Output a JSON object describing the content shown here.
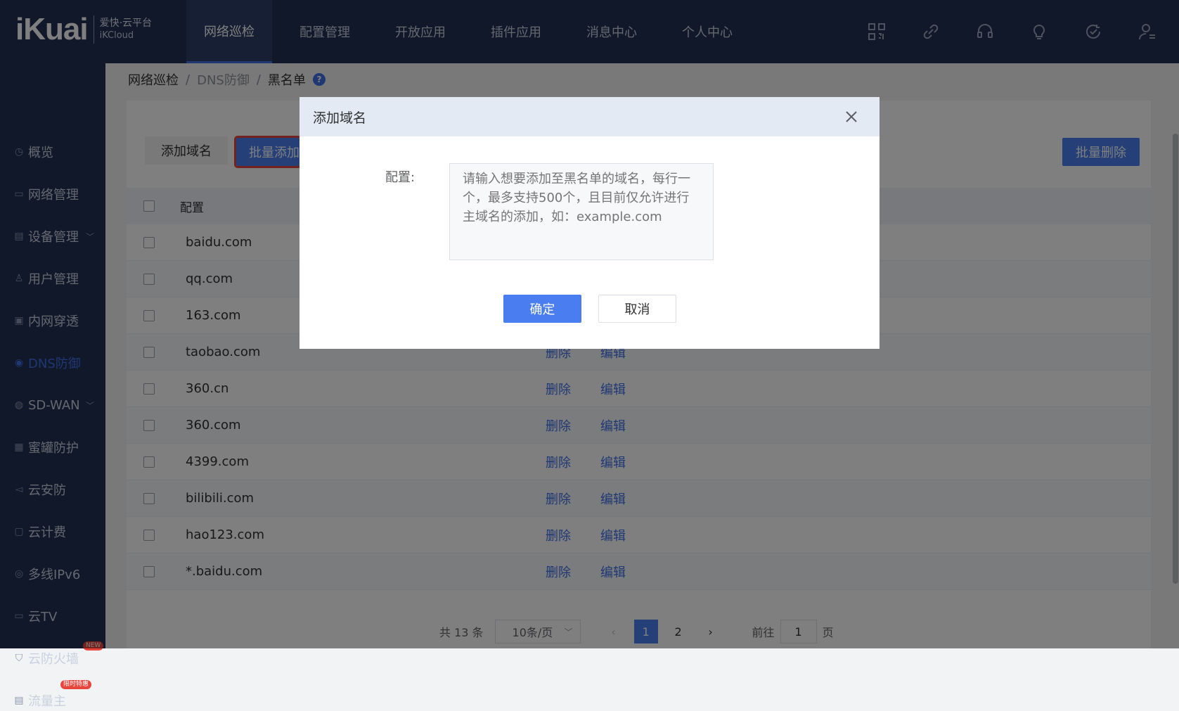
{
  "brand": {
    "logo_text": "iKuai",
    "cn_name": "爱快·云平台",
    "en_name": "iKCloud"
  },
  "top_nav": [
    {
      "label": "网络巡检"
    },
    {
      "label": "配置管理"
    },
    {
      "label": "开放应用"
    },
    {
      "label": "插件应用"
    },
    {
      "label": "消息中心"
    },
    {
      "label": "个人中心"
    }
  ],
  "top_icons": [
    "qrcode-icon",
    "link-icon",
    "headset-icon",
    "lightbulb-icon",
    "refresh-target-icon",
    "user-icon"
  ],
  "sidebar": {
    "items": [
      {
        "label": "概览",
        "icon": "clock-icon"
      },
      {
        "label": "网络管理",
        "icon": "monitor-icon"
      },
      {
        "label": "设备管理",
        "icon": "device-icon",
        "has_children": true
      },
      {
        "label": "用户管理",
        "icon": "user-icon"
      },
      {
        "label": "内网穿透",
        "icon": "tunnel-icon"
      },
      {
        "label": "DNS防御",
        "icon": "dns-icon",
        "active": true
      },
      {
        "label": "SD-WAN",
        "icon": "globe-icon",
        "has_children": true
      },
      {
        "label": "蜜罐防护",
        "icon": "honeypot-icon"
      },
      {
        "label": "云安防",
        "icon": "camera-icon"
      },
      {
        "label": "云计费",
        "icon": "billing-icon"
      },
      {
        "label": "多线IPv6",
        "icon": "ipv6-icon"
      },
      {
        "label": "云TV",
        "icon": "tv-icon"
      },
      {
        "label": "云防火墙",
        "icon": "shield-icon",
        "badge": "NEW"
      },
      {
        "label": "流量主",
        "icon": "traffic-icon",
        "badge": "限时特惠"
      }
    ]
  },
  "breadcrumb": {
    "l1": "网络巡检",
    "l2": "DNS防御",
    "l3": "黑名单",
    "sep": "/",
    "help": "?"
  },
  "toolbar": {
    "add_domain": "添加域名",
    "batch_add": "批量添加",
    "batch_delete": "批量删除"
  },
  "table": {
    "header": "配置",
    "rows": [
      {
        "domain": "baidu.com"
      },
      {
        "domain": "qq.com"
      },
      {
        "domain": "163.com"
      },
      {
        "domain": "taobao.com"
      },
      {
        "domain": "360.cn"
      },
      {
        "domain": "360.com"
      },
      {
        "domain": "4399.com"
      },
      {
        "domain": "bilibili.com"
      },
      {
        "domain": "hao123.com"
      },
      {
        "domain": "*.baidu.com"
      }
    ],
    "action_delete": "删除",
    "action_edit": "编辑"
  },
  "pagination": {
    "total": "共 13 条",
    "page_size": "10条/页",
    "pages": [
      "1",
      "2"
    ],
    "current": "1",
    "goto_prefix": "前往",
    "goto_value": "1",
    "goto_suffix": "页"
  },
  "modal": {
    "title": "添加域名",
    "field_label": "配置:",
    "placeholder": "请输入想要添加至黑名单的域名，每行一个，最多支持500个，且目前仅允许进行主域名的添加，如：example.com",
    "ok": "确定",
    "cancel": "取消"
  },
  "colors": {
    "nav_bg": "#223152",
    "accent": "#4a7ef0",
    "highlight": "#e8453c"
  }
}
